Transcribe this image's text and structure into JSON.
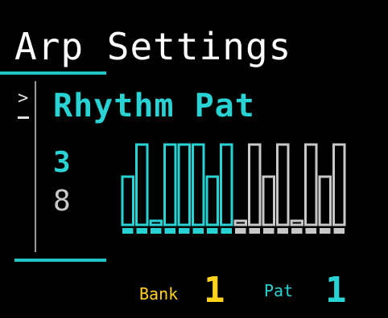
{
  "screen": {
    "title": "Arp Settings",
    "menu": {
      "cursor": ">",
      "item_label": "Rhythm Pat"
    },
    "pattern": {
      "active_length": "3",
      "total_length": "8",
      "steps_active_color": "#29d3d3",
      "steps_inactive_color": "#c8c8c8",
      "steps": [
        0.6,
        1.0,
        0.05,
        1.0,
        1.0,
        1.0,
        0.6,
        1.0,
        0.05,
        1.0,
        0.6,
        1.0,
        0.05,
        1.0,
        0.6,
        1.0
      ],
      "steps_active_count": 8
    },
    "status": {
      "bank_label": "Bank",
      "bank_value": "1",
      "pat_label": "Pat",
      "pat_value": "1"
    }
  },
  "colors": {
    "accent": "#29d3d3",
    "yellow": "#ffd21c",
    "background": "#000000"
  }
}
